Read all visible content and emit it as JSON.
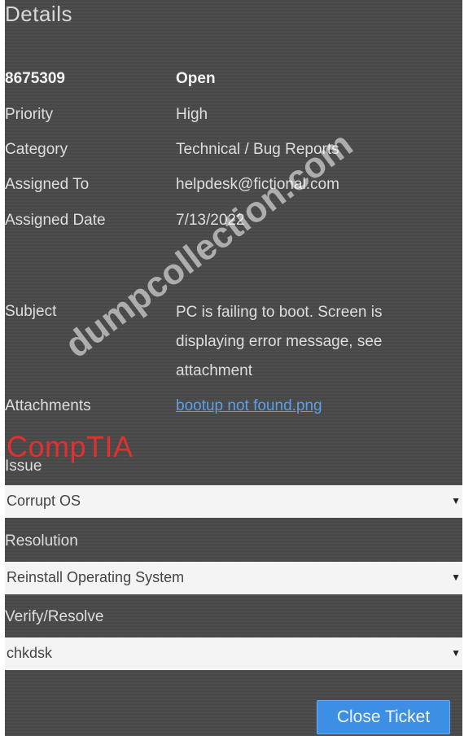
{
  "header": {
    "title": "Details"
  },
  "ticket": {
    "number": "8675309",
    "status": "Open",
    "fields": {
      "priority_label": "Priority",
      "priority_value": "High",
      "category_label": "Category",
      "category_value": "Technical / Bug Reports",
      "assigned_to_label": "Assigned To",
      "assigned_to_value": "helpdesk@fictional.com",
      "assigned_date_label": "Assigned Date",
      "assigned_date_value": "7/13/2022",
      "subject_label": "Subject",
      "subject_value": "PC is failing to boot. Screen is displaying error message, see attachment",
      "attachments_label": "Attachments",
      "attachment_link": "bootup not found.png"
    }
  },
  "branding": {
    "logo_text": "CompTIA",
    "watermark": "dumpcollection.com"
  },
  "form": {
    "issue_label": "Issue",
    "issue_value": "Corrupt OS",
    "resolution_label": "Resolution",
    "resolution_value": "Reinstall Operating System",
    "verify_label": "Verify/Resolve",
    "verify_value": "chkdsk",
    "close_button": "Close Ticket"
  },
  "colors": {
    "panel_bg": "#4a4a4a",
    "link": "#5aa0e8",
    "button": "#3d8fe6",
    "brand_red": "#e03030"
  },
  "icons": {
    "dropdown": "caret-down-icon"
  }
}
